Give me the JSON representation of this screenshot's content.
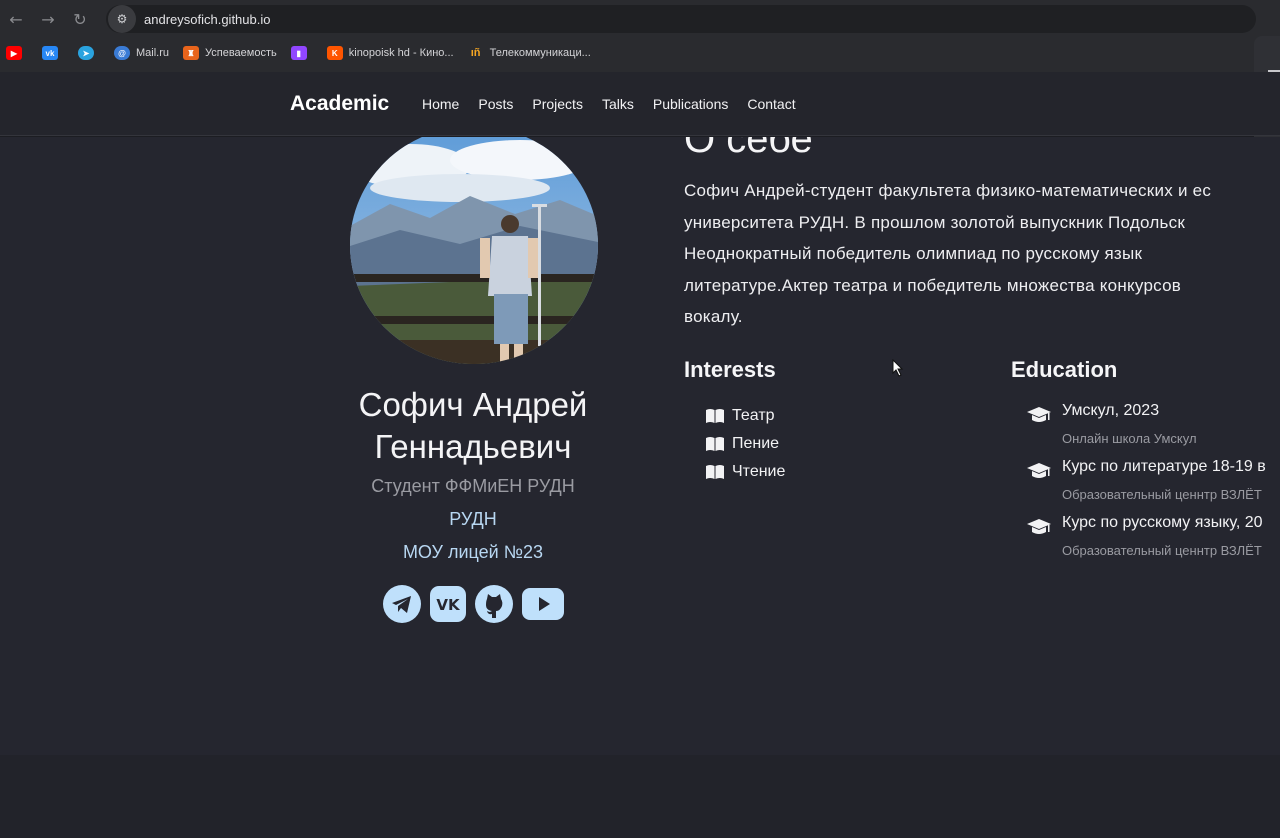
{
  "browser": {
    "url": "andreysofich.github.io",
    "bookmarks": [
      {
        "label": "",
        "icon": "youtube-icon",
        "color": "#ff0000"
      },
      {
        "label": "",
        "icon": "vk-icon",
        "color": "#2787f5"
      },
      {
        "label": "",
        "icon": "telegram-icon",
        "color": "#2aa3df"
      },
      {
        "label": "Mail.ru",
        "icon": "mailru-icon",
        "color": "#3a7bd5"
      },
      {
        "label": "Успеваемость",
        "icon": "university-icon",
        "color": "#e8641b"
      },
      {
        "label": "",
        "icon": "twitch-icon",
        "color": "#9146ff"
      },
      {
        "label": "kinopoisk hd - Кино...",
        "icon": "kinopoisk-icon",
        "color": "#ff5500"
      },
      {
        "label": "Телекоммуникаци...",
        "icon": "orange-icon",
        "color": "#f5a623"
      }
    ]
  },
  "nav": {
    "brand": "Academic",
    "items": [
      "Home",
      "Posts",
      "Projects",
      "Talks",
      "Publications",
      "Contact"
    ]
  },
  "profile": {
    "name": "Софич Андрей Геннадьевич",
    "role": "Студент ФФМиЕН РУДН",
    "organizations": [
      "РУДН",
      "МОУ лицей №23"
    ],
    "socials": [
      "telegram-icon",
      "vk-icon",
      "github-icon",
      "youtube-icon"
    ]
  },
  "about": {
    "title": "О себе",
    "lines": [
      "Софич Андрей-студент факультета физико-математических и ес",
      "университета РУДН. В прошлом золотой выпускник Подольск",
      "Неоднократный победитель олимпиад по русскому язык",
      "литературе.Актер театра и победитель множества конкурсов",
      "вокалу."
    ]
  },
  "interests": {
    "title": "Interests",
    "items": [
      "Театр",
      "Пение",
      "Чтение"
    ]
  },
  "education": {
    "title": "Education",
    "items": [
      {
        "course": "Умскул, 2023",
        "institution": "Онлайн школа Умскул"
      },
      {
        "course": "Курс по литературе 18-19 в",
        "institution": "Образовательный ценнтр ВЗЛЁТ"
      },
      {
        "course": "Курс по русскому языку, 20",
        "institution": "Образовательный ценнтр ВЗЛЁТ"
      }
    ]
  },
  "colors": {
    "background": "#25262f",
    "nav_background": "#24252c",
    "link_accent": "#b8d7f2",
    "social_icon": "#bfe0fb"
  }
}
